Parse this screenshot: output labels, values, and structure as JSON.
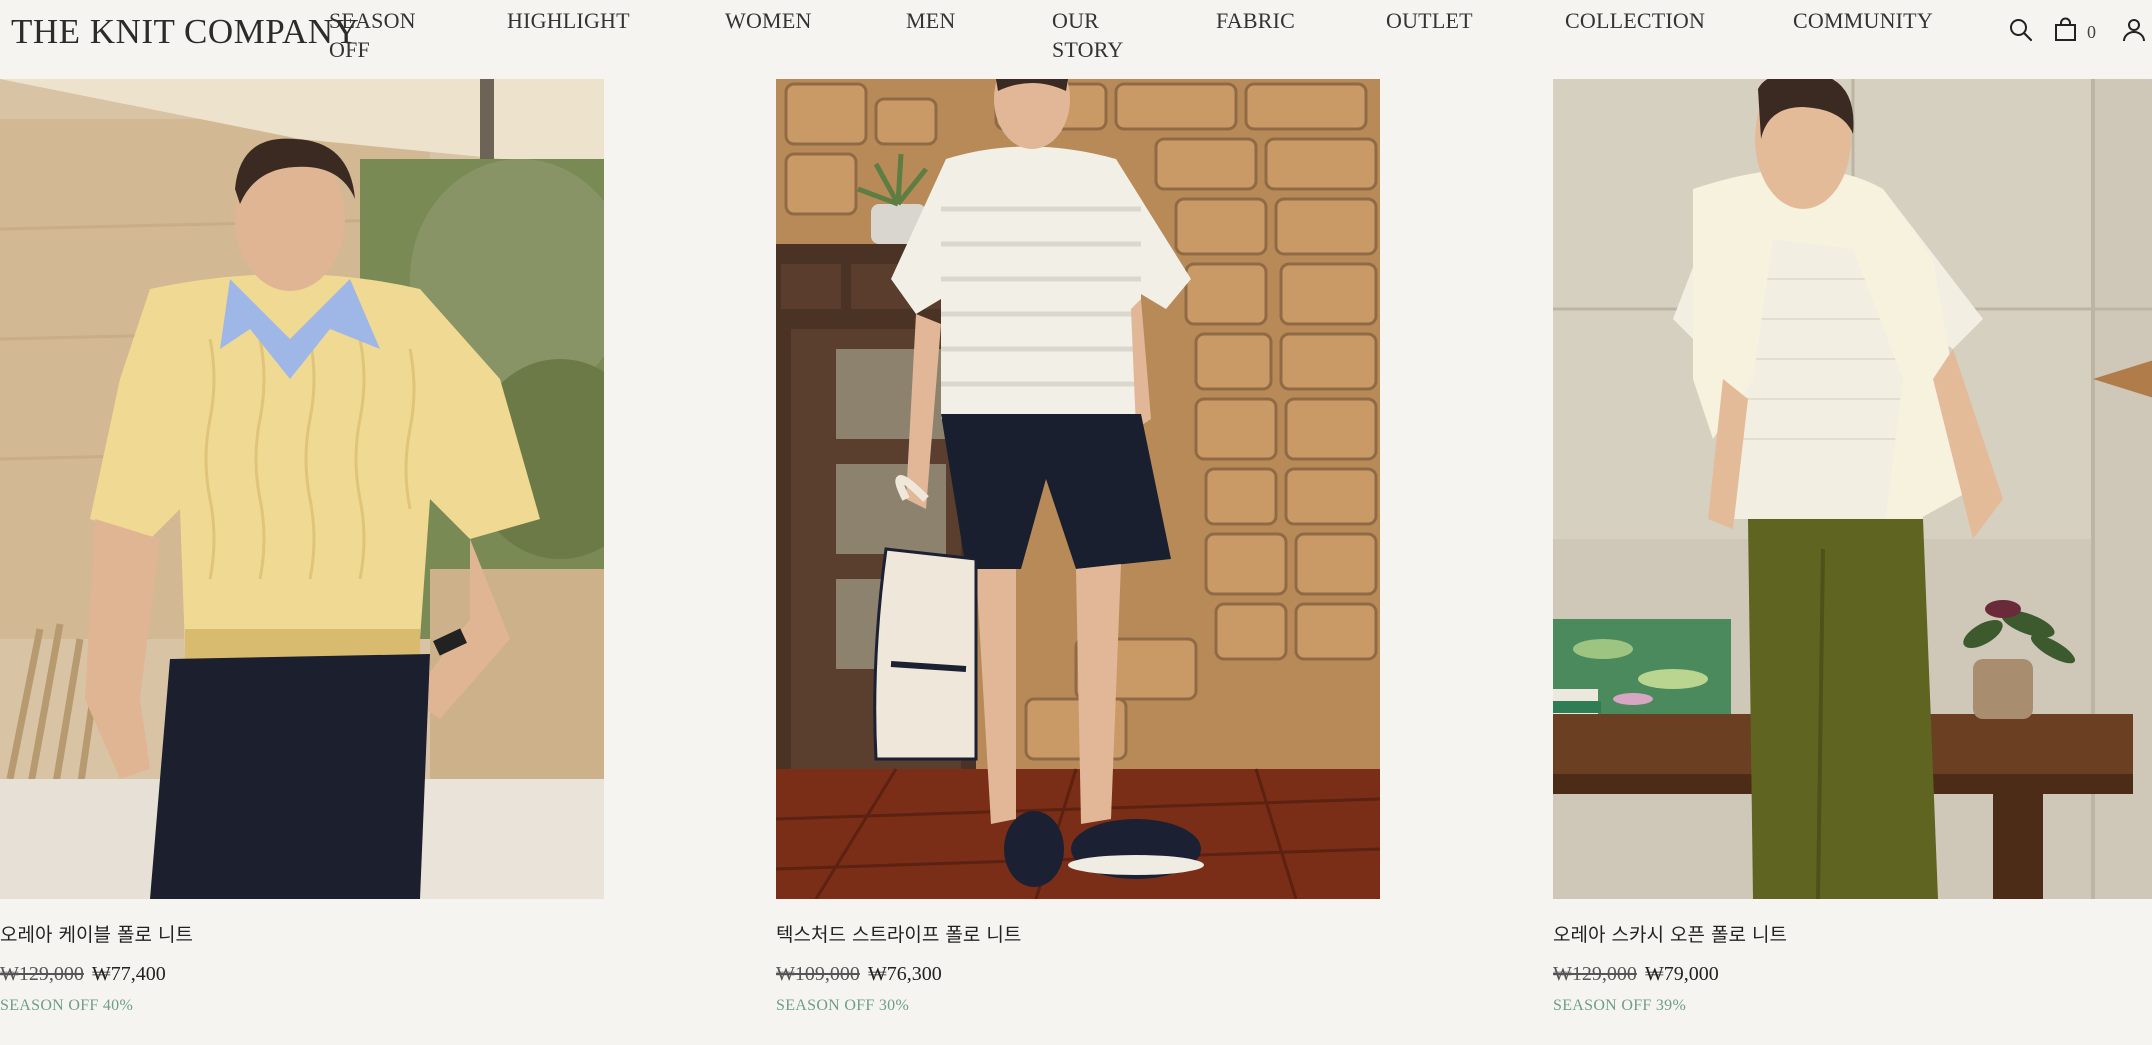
{
  "brand": {
    "logo": "THE KNIT COMPANY"
  },
  "nav": [
    {
      "line1": "SEASON",
      "line2": "OFF"
    },
    {
      "line1": "HIGHLIGHT",
      "line2": ""
    },
    {
      "line1": "WOMEN",
      "line2": ""
    },
    {
      "line1": "MEN",
      "line2": ""
    },
    {
      "line1": "OUR",
      "line2": "STORY"
    },
    {
      "line1": "FABRIC",
      "line2": ""
    },
    {
      "line1": "OUTLET",
      "line2": ""
    },
    {
      "line1": "COLLECTION",
      "line2": ""
    },
    {
      "line1": "COMMUNITY",
      "line2": ""
    }
  ],
  "header_icons": {
    "search": "search-icon",
    "cart": "shopping-bag-icon",
    "account": "user-icon"
  },
  "cart": {
    "count": "0"
  },
  "products": [
    {
      "name": "오레아 케이블 폴로 니트",
      "original_price": "₩129,000",
      "sale_price": "₩77,400",
      "badge": "SEASON OFF 40%"
    },
    {
      "name": "텍스처드 스트라이프 폴로 니트",
      "original_price": "₩109,000",
      "sale_price": "₩76,300",
      "badge": "SEASON OFF 30%"
    },
    {
      "name": "오레아 스카시 오픈 폴로 니트",
      "original_price": "₩129,000",
      "sale_price": "₩79,000",
      "badge": "SEASON OFF 39%"
    }
  ],
  "colors": {
    "background": "#f5f4f0",
    "badge_green": "#6f9e86",
    "text": "#222222"
  }
}
